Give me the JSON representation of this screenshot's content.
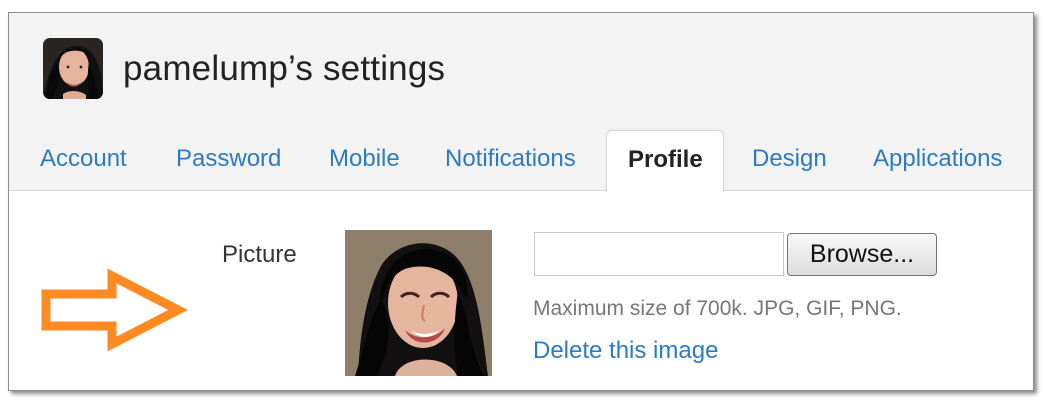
{
  "header": {
    "title": "pamelump’s settings"
  },
  "tabs": [
    {
      "label": "Account",
      "active": false
    },
    {
      "label": "Password",
      "active": false
    },
    {
      "label": "Mobile",
      "active": false
    },
    {
      "label": "Notifications",
      "active": false
    },
    {
      "label": "Profile",
      "active": true
    },
    {
      "label": "Design",
      "active": false
    },
    {
      "label": "Applications",
      "active": false
    }
  ],
  "profile": {
    "picture_label": "Picture",
    "file_value": "",
    "browse_label": "Browse...",
    "help_text": "Maximum size of 700k. JPG, GIF, PNG.",
    "delete_link": "Delete this image"
  },
  "colors": {
    "link_blue": "#2d7bc2",
    "header_background": "#f3f3f3",
    "annotation_arrow": "#ff8a22"
  },
  "icons": {
    "user_avatar": "avatar",
    "profile_photo": "profile-photo",
    "annotation": "orange-right-arrow-icon"
  }
}
